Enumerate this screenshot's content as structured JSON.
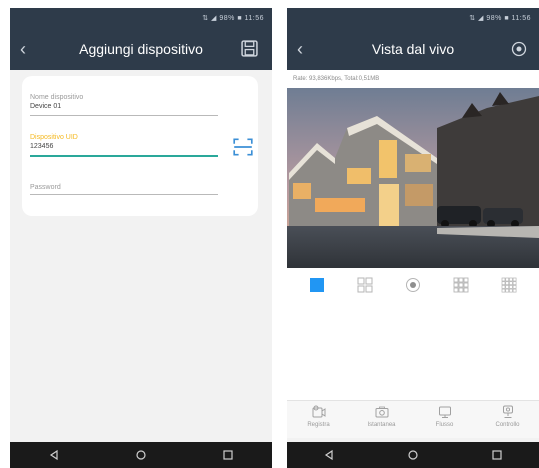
{
  "left_screen": {
    "status_text": "⇅ ◢ 98% ■ 11:56",
    "title": "Aggiungi dispositivo",
    "fields": {
      "name": {
        "label": "Nome dispositivo",
        "value": "Device 01"
      },
      "uid": {
        "label": "Dispositivo UID",
        "value": "123456"
      },
      "password": {
        "label": "Password"
      }
    },
    "icons": {
      "back": "back-chevron-icon",
      "save": "save-icon",
      "scan": "qr-scan-icon"
    }
  },
  "right_screen": {
    "status_text": "⇅ ◢ 98% ■ 11:56",
    "title": "Vista dal vivo",
    "rate_text": "Rate: 93,836Kbps, Total:0,51MB",
    "actions": [
      {
        "label": "Registra",
        "icon": "record-video-icon"
      },
      {
        "label": "Istantanea",
        "icon": "camera-icon"
      },
      {
        "label": "Flusso",
        "icon": "stream-icon"
      },
      {
        "label": "Controllo",
        "icon": "ptz-control-icon"
      }
    ],
    "layout_icons": [
      "single-view-icon",
      "quad-view-icon",
      "record-dot-icon",
      "nine-view-icon",
      "sixteen-view-icon"
    ]
  },
  "colors": {
    "header_bg": "#2e3b4a",
    "accent": "#2aa89a",
    "uid_label": "#f5b921",
    "selected_layout": "#2196f3"
  }
}
